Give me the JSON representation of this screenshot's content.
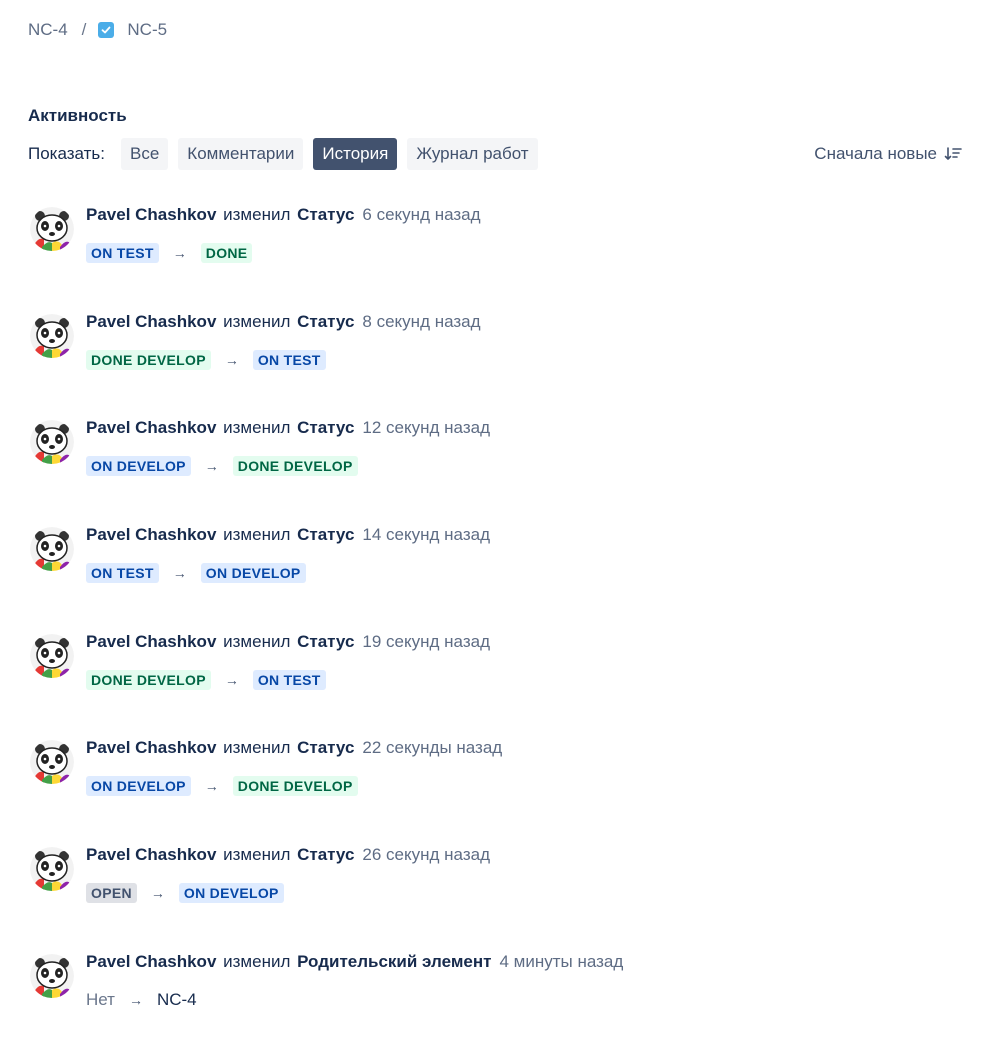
{
  "breadcrumb": {
    "parent": "NC-4",
    "separator": "/",
    "current": "NC-5",
    "current_icon": "task-checkbox-icon"
  },
  "activity": {
    "title": "Активность",
    "show_label": "Показать:",
    "filters": [
      "Все",
      "Комментарии",
      "История",
      "Журнал работ"
    ],
    "active_filter": "История",
    "sort_label": "Сначала новые",
    "sort_icon": "sort-descending-icon"
  },
  "entries": [
    {
      "actor": "Pavel Chashkov",
      "verb": "изменил",
      "field": "Статус",
      "time": "6 секунд назад",
      "from": "ON TEST",
      "to": "DONE"
    },
    {
      "actor": "Pavel Chashkov",
      "verb": "изменил",
      "field": "Статус",
      "time": "8 секунд назад",
      "from": "DONE DEVELOP",
      "to": "ON TEST"
    },
    {
      "actor": "Pavel Chashkov",
      "verb": "изменил",
      "field": "Статус",
      "time": "12 секунд назад",
      "from": "ON DEVELOP",
      "to": "DONE DEVELOP"
    },
    {
      "actor": "Pavel Chashkov",
      "verb": "изменил",
      "field": "Статус",
      "time": "14 секунд назад",
      "from": "ON TEST",
      "to": "ON DEVELOP"
    },
    {
      "actor": "Pavel Chashkov",
      "verb": "изменил",
      "field": "Статус",
      "time": "19 секунд назад",
      "from": "DONE DEVELOP",
      "to": "ON TEST"
    },
    {
      "actor": "Pavel Chashkov",
      "verb": "изменил",
      "field": "Статус",
      "time": "22 секунды назад",
      "from": "ON DEVELOP",
      "to": "DONE DEVELOP"
    },
    {
      "actor": "Pavel Chashkov",
      "verb": "изменил",
      "field": "Статус",
      "time": "26 секунд назад",
      "from": "OPEN",
      "to": "ON DEVELOP"
    },
    {
      "actor": "Pavel Chashkov",
      "verb": "изменил",
      "field": "Родительский элемент",
      "time": "4 минуты назад",
      "from": "Нет",
      "to": "NC-4"
    }
  ],
  "arrow": "→",
  "colors": {
    "blue_lozenge_bg": "#deebff",
    "blue_lozenge_text": "#0747a6",
    "green_lozenge_bg": "#e3fcef",
    "green_lozenge_text": "#006644",
    "grey_lozenge_bg": "#dfe1e6",
    "grey_lozenge_text": "#42526e",
    "active_filter_bg": "#42526e",
    "task_icon": "#4bade8"
  }
}
